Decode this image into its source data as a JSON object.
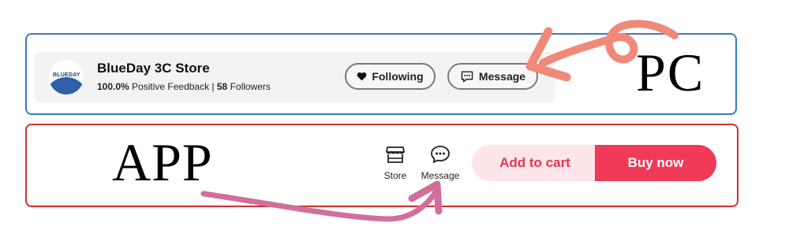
{
  "pc": {
    "label": "PC",
    "store": {
      "logo_text": "BLUEDAY",
      "name": "BlueDay 3C Store",
      "feedback_percent": "100.0%",
      "feedback_text": " Positive Feedback | ",
      "followers_count": "58",
      "followers_text": " Followers"
    },
    "following_label": "Following",
    "message_label": "Message"
  },
  "app": {
    "label": "APP",
    "store_label": "Store",
    "message_label": "Message",
    "add_to_cart_label": "Add to cart",
    "buy_now_label": "Buy now"
  },
  "colors": {
    "pc_frame": "#3b79c0",
    "app_frame": "#d32f2f",
    "pc_arrow": "#ef8a7a",
    "app_arrow": "#d0709a",
    "buy_now_bg": "#f03a57",
    "add_to_cart_bg": "#fde6ea"
  }
}
